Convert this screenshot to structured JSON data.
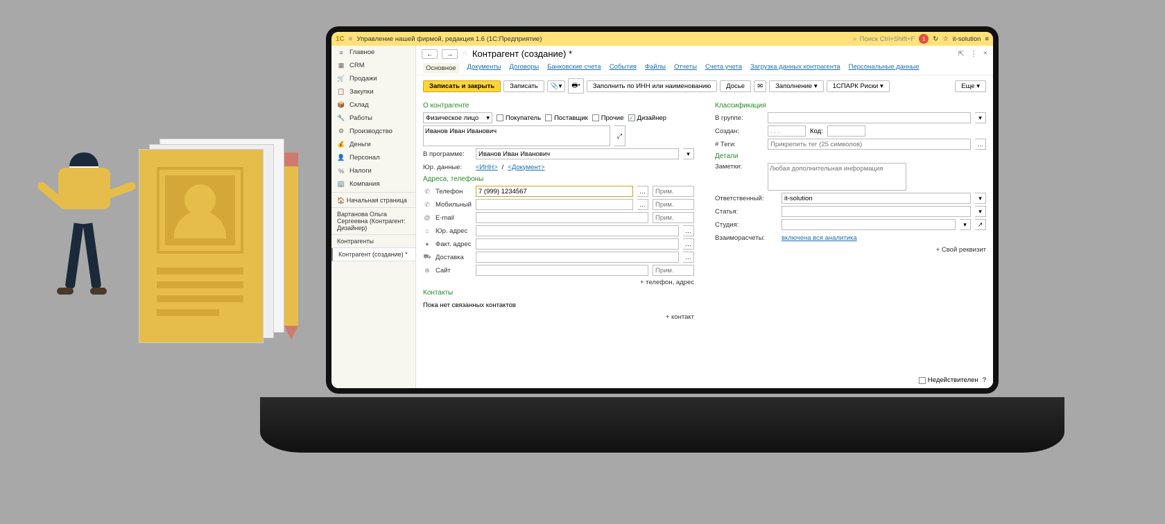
{
  "titlebar": {
    "logo": "1С",
    "title": "Управление нашей фирмой, редакция 1.6  (1С:Предприятие)",
    "search_placeholder": "Поиск Ctrl+Shift+F",
    "user": "it-solution",
    "bell_count": "1"
  },
  "sidebar": {
    "items": [
      {
        "icon": "≡",
        "label": "Главное"
      },
      {
        "icon": "▦",
        "label": "CRM"
      },
      {
        "icon": "🛒",
        "label": "Продажи"
      },
      {
        "icon": "📋",
        "label": "Закупки"
      },
      {
        "icon": "📦",
        "label": "Склад"
      },
      {
        "icon": "🔧",
        "label": "Работы"
      },
      {
        "icon": "⚙",
        "label": "Производство"
      },
      {
        "icon": "💰",
        "label": "Деньги"
      },
      {
        "icon": "👤",
        "label": "Персонал"
      },
      {
        "icon": "%",
        "label": "Налоги"
      },
      {
        "icon": "🏢",
        "label": "Компания"
      }
    ],
    "tabs": [
      {
        "icon": "🏠",
        "label": "Начальная страница"
      },
      {
        "icon": "",
        "label": "Вартанова Ольга Сергеевна (Контрагент: Дизайнер)"
      },
      {
        "icon": "",
        "label": "Контрагенты"
      },
      {
        "icon": "",
        "label": "Контрагент (создание) *"
      }
    ]
  },
  "page": {
    "title": "Контрагент (создание) *",
    "tabs": [
      "Основное",
      "Документы",
      "Договоры",
      "Банковские счета",
      "События",
      "Файлы",
      "Отчеты",
      "Счета учета",
      "Загрузка данных контрагента",
      "Персональные данные"
    ]
  },
  "toolbar": {
    "save_close": "Записать и закрыть",
    "save": "Записать",
    "fill_by_inn": "Заполнить по ИНН или наименованию",
    "dossier": "Досье",
    "fill": "Заполнение",
    "spark": "1СПАРК Риски",
    "more": "Еще"
  },
  "form": {
    "about_title": "О контрагенте",
    "type_value": "Физическое лицо",
    "buyer": "Покупатель",
    "supplier": "Поставщик",
    "other": "Прочие",
    "designer": "Дизайнер",
    "name_value": "Иванов Иван Иванович",
    "in_program_label": "В программе:",
    "in_program_value": "Иванов Иван Иванович",
    "legal_label": "Юр. данные:",
    "legal_inn": "<ИНН>",
    "legal_doc": "<Документ>",
    "addresses_title": "Адреса, телефоны",
    "phone_label": "Телефон",
    "phone_value": "7 (999) 1234567",
    "note_placeholder": "Прим.",
    "mobile_label": "Мобильный",
    "email_label": "E-mail",
    "legal_addr_label": "Юр. адрес",
    "fact_addr_label": "Факт. адрес",
    "delivery_label": "Доставка",
    "site_label": "Сайт",
    "add_phone": "+ телефон, адрес",
    "contacts_title": "Контакты",
    "contacts_empty": "Пока нет связанных контактов",
    "add_contact": "+ контакт",
    "class_title": "Классификация",
    "group_label": "В группе:",
    "created_label": "Создан:",
    "created_placeholder": ". . .",
    "code_label": "Код:",
    "tags_label": "# Теги:",
    "tags_placeholder": "Прикрепить тег (25 символов)",
    "details_title": "Детали",
    "notes_label": "Заметки:",
    "notes_placeholder": "Любая дополнительная информация",
    "responsible_label": "Ответственный:",
    "responsible_value": "it-solution",
    "status_label": "Статья:",
    "studio_label": "Студия:",
    "settlements_label": "Взаиморасчеты:",
    "settlements_value": "включена вся аналитика",
    "add_req": "+ Свой реквизит"
  },
  "footer": {
    "invalid": "Недействителен",
    "help": "?"
  }
}
